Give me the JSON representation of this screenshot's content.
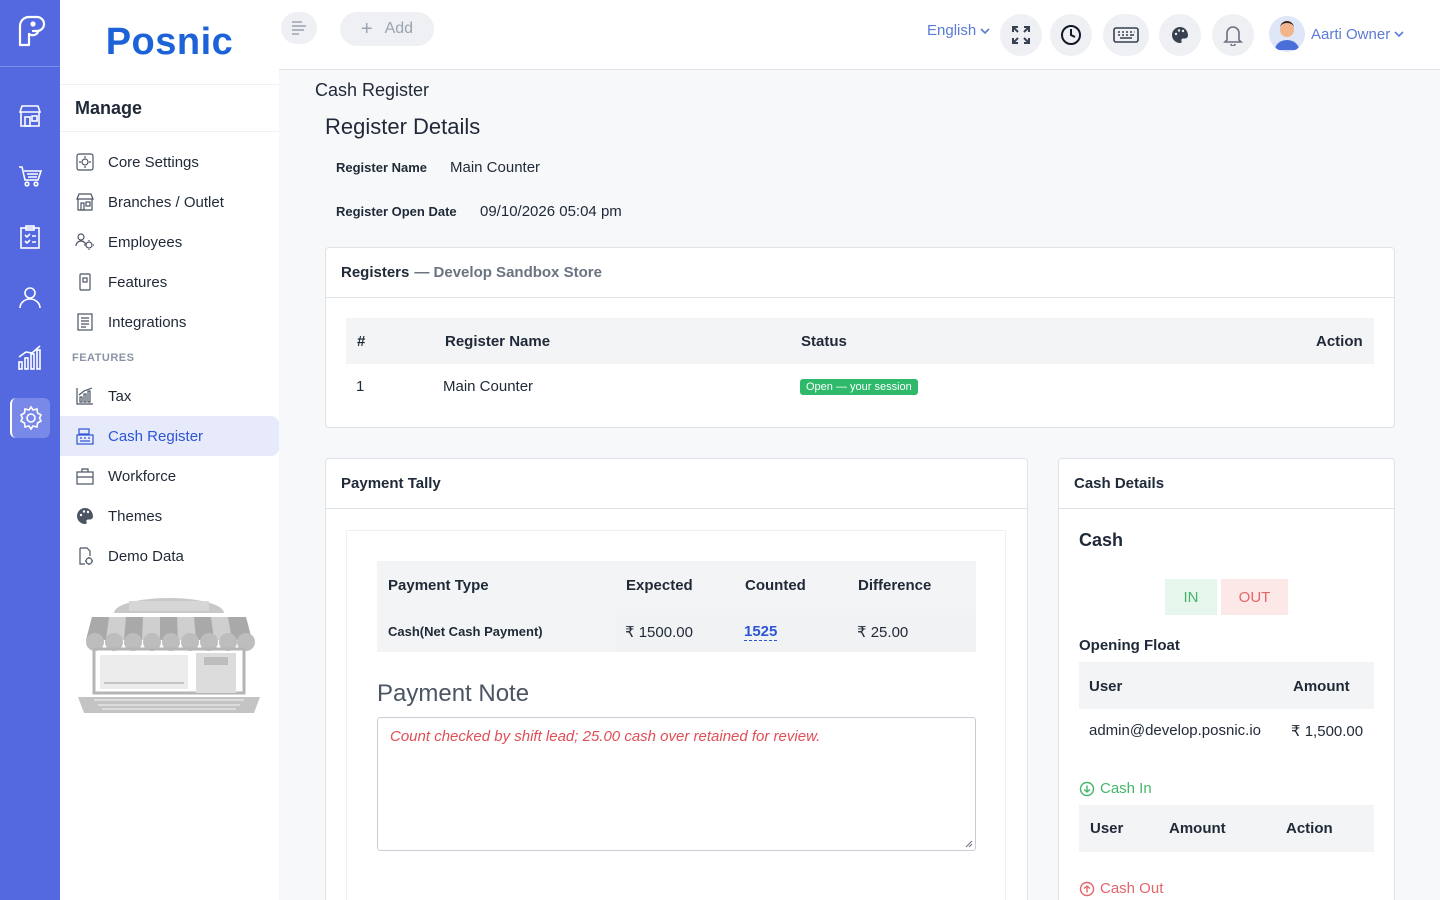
{
  "app": {
    "brand": "Posnic"
  },
  "rail": {
    "items": [
      "store-icon",
      "cart-icon",
      "clipboard-icon",
      "user-icon",
      "analytics-icon",
      "settings-icon"
    ],
    "active": "settings-icon"
  },
  "sidebar": {
    "heading": "Manage",
    "items": [
      {
        "label": "Core Settings",
        "icon": "core-settings-icon"
      },
      {
        "label": "Branches / Outlet",
        "icon": "branches-icon"
      },
      {
        "label": "Employees",
        "icon": "employees-icon"
      },
      {
        "label": "Features",
        "icon": "features-icon"
      },
      {
        "label": "Integrations",
        "icon": "integrations-icon"
      }
    ],
    "section_label": "FEATURES",
    "feature_items": [
      {
        "label": "Tax",
        "icon": "tax-icon"
      },
      {
        "label": "Cash Register",
        "icon": "cash-register-icon",
        "active": true
      },
      {
        "label": "Workforce",
        "icon": "workforce-icon"
      },
      {
        "label": "Themes",
        "icon": "palette-icon"
      },
      {
        "label": "Demo Data",
        "icon": "demo-data-icon"
      }
    ]
  },
  "topbar": {
    "add_label": "Add",
    "language": "English",
    "icons": [
      "fullscreen-icon",
      "clock-icon",
      "keyboard-icon",
      "palette-icon",
      "bell-icon"
    ],
    "user_name": "Aarti Owner"
  },
  "page": {
    "breadcrumb": "Cash Register",
    "title": "Register Details",
    "register_name_label": "Register Name",
    "register_name_value": "Main Counter",
    "open_date_label": "Register Open Date",
    "open_date_value": "09/10/2026 05:04 pm"
  },
  "registers_card": {
    "title": "Registers",
    "subtitle": "— Develop Sandbox Store",
    "columns": [
      "#",
      "Register Name",
      "Status",
      "Action"
    ],
    "rows": [
      {
        "num": "1",
        "name": "Main Counter",
        "status": "Open — your session"
      }
    ]
  },
  "payment_tally": {
    "title": "Payment Tally",
    "columns": [
      "Payment Type",
      "Expected",
      "Counted",
      "Difference"
    ],
    "row": {
      "type": "Cash(Net Cash Payment)",
      "expected": "₹ 1500.00",
      "counted": "1525",
      "difference": "₹ 25.00"
    },
    "note_title": "Payment Note",
    "note_text": "Count checked by shift lead; 25.00 cash over retained for review."
  },
  "cash_details": {
    "title": "Cash Details",
    "heading": "Cash",
    "in_label": "IN",
    "out_label": "OUT",
    "opening_float_title": "Opening Float",
    "float_columns": [
      "User",
      "Amount"
    ],
    "float_row": {
      "user": "admin@develop.posnic.io",
      "amount": "₹ 1,500.00"
    },
    "cash_in_label": "Cash In",
    "cash_in_columns": [
      "User",
      "Amount",
      "Action"
    ],
    "cash_out_label": "Cash Out"
  },
  "colors": {
    "rail": "#5468e0",
    "brand": "#1d63d8",
    "accent": "#2e55d6",
    "success": "#2fb96b",
    "danger": "#e04e57"
  }
}
